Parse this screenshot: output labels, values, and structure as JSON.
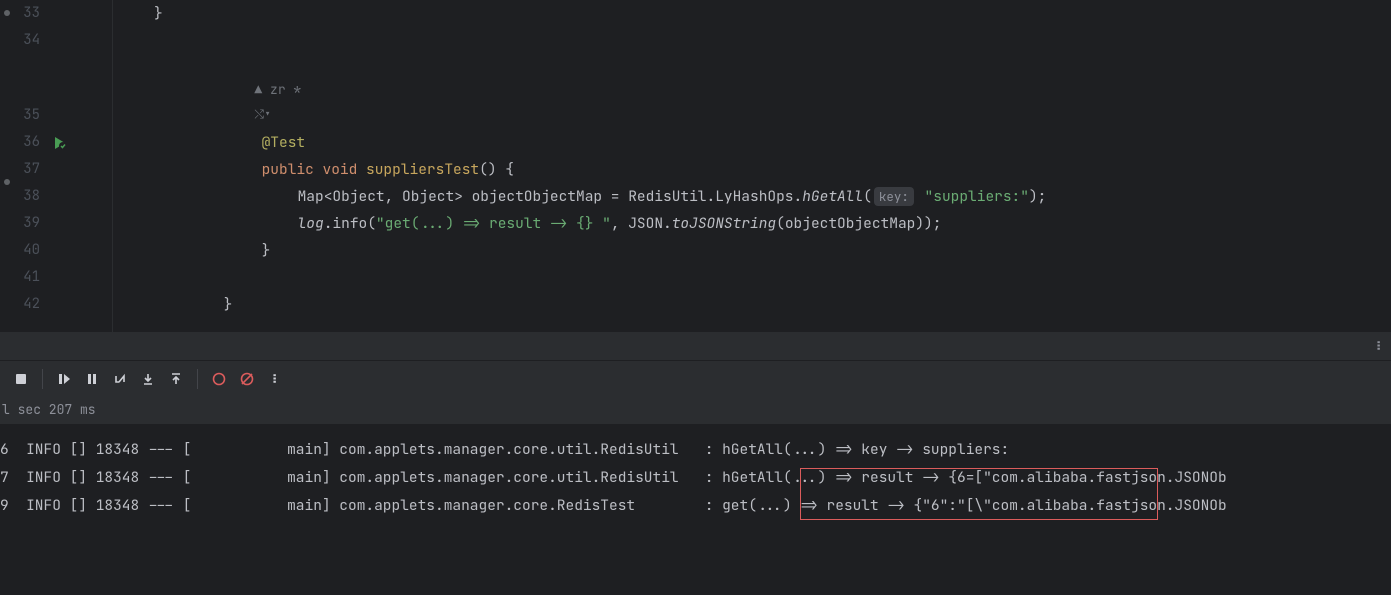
{
  "editor": {
    "line33_brace": "}",
    "annotation_author": "zr *",
    "annotation_icon_label": "⇄",
    "test_annotation": "@Test",
    "kw_public": "public",
    "kw_void": "void",
    "method_name": "suppliersTest",
    "method_parens": "()",
    "brace_open": "{",
    "l37_a": "Map<Object, Object> objectObjectMap = RedisUtil.LyHashOps.",
    "l37_m": "hGetAll",
    "l37_open": "(",
    "l37_hint": "key:",
    "l37_str": "\"suppliers:\"",
    "l37_close": ");",
    "l38_a": "log",
    "l38_b": ".info(",
    "l38_str": "\"get(...) => result -> {} \"",
    "l38_c": ", JSON.",
    "l38_m": "toJSONString",
    "l38_d": "(objectObjectMap));",
    "brace_close_inner": "}",
    "brace_close_outer": "}",
    "line_numbers": {
      "n33": "33",
      "n34": "34",
      "n35": "35",
      "n36": "36",
      "n37": "37",
      "n38": "38",
      "n39": "39",
      "n40": "40",
      "n41": "41",
      "n42": "42"
    }
  },
  "toolbar": {
    "status_text": "l sec 207 ms"
  },
  "console": {
    "rows": [
      {
        "n": "6",
        "lvl": "INFO",
        "pid": "18348",
        "thr": "main",
        "cls": "com.applets.manager.core.util.RedisUtil",
        "msg": "hGetAll(...) => key -> suppliers:"
      },
      {
        "n": "7",
        "lvl": "INFO",
        "pid": "18348",
        "thr": "main",
        "cls": "com.applets.manager.core.util.RedisUtil",
        "msg": "hGetAll(...) => result -> {6=[\"com.alibaba.fastjson.JSONOb"
      },
      {
        "n": "9",
        "lvl": "INFO",
        "pid": "18348",
        "thr": "main",
        "cls": "com.applets.manager.core.RedisTest",
        "msg": "get(...) => result -> {\"6\":\"[\\\"com.alibaba.fastjson.JSONOb"
      }
    ]
  }
}
